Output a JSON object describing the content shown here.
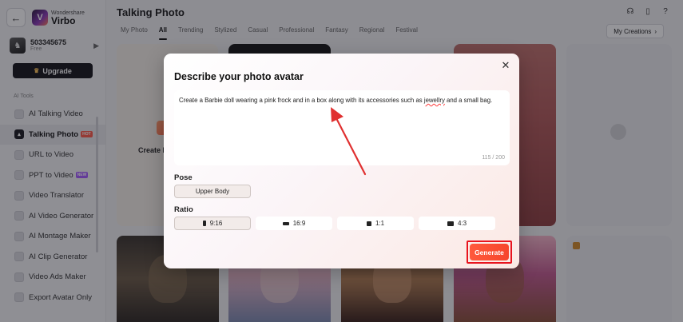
{
  "app": {
    "brand_small": "Wondershare",
    "brand_name": "Virbo"
  },
  "account": {
    "id": "503345675",
    "plan": "Free",
    "upgrade_label": "Upgrade"
  },
  "sidebar": {
    "section_label": "AI Tools",
    "items": [
      {
        "label": "AI Talking Video",
        "badge": ""
      },
      {
        "label": "Talking Photo",
        "badge": "HOT"
      },
      {
        "label": "URL to Video",
        "badge": ""
      },
      {
        "label": "PPT to Video",
        "badge": "NEW"
      },
      {
        "label": "Video Translator",
        "badge": ""
      },
      {
        "label": "AI Video Generator",
        "badge": ""
      },
      {
        "label": "AI Montage Maker",
        "badge": ""
      },
      {
        "label": "AI Clip Generator",
        "badge": ""
      },
      {
        "label": "Video Ads Maker",
        "badge": ""
      },
      {
        "label": "Export Avatar Only",
        "badge": ""
      }
    ]
  },
  "main": {
    "title": "Talking Photo",
    "tabs": [
      "My Photo",
      "All",
      "Trending",
      "Stylized",
      "Casual",
      "Professional",
      "Fantasy",
      "Regional",
      "Festival"
    ],
    "active_tab": "All",
    "my_creations_label": "My Creations",
    "create_card_label": "Create P"
  },
  "modal": {
    "title": "Describe your photo avatar",
    "prompt_before": "Create a Barbie doll wearing a pink frock and in a box along with its accessories such as ",
    "prompt_misspelled": "jewellry",
    "prompt_after": " and a small bag.",
    "char_count": "115 / 200",
    "pose_label": "Pose",
    "pose_option": "Upper Body",
    "ratio_label": "Ratio",
    "ratios": [
      "9:16",
      "16:9",
      "1:1",
      "4:3"
    ],
    "selected_ratio": "9:16",
    "generate_label": "Generate"
  },
  "colors": {
    "accent": "#f6462c",
    "highlight_box": "#e8141e",
    "annotation_arrow": "#e03030"
  }
}
